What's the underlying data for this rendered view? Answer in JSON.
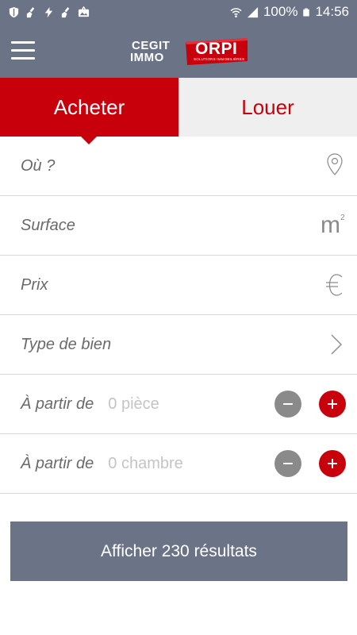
{
  "status_bar": {
    "battery": "100%",
    "time": "14:56"
  },
  "app_bar": {
    "logo_line1": "CEGIT",
    "logo_line2": "IMMO",
    "brand": "ORPI",
    "brand_tagline": "SOLUTIONS IMMOBILIÈRES"
  },
  "tabs": [
    {
      "label": "Acheter",
      "active": true
    },
    {
      "label": "Louer",
      "active": false
    }
  ],
  "form": {
    "location": {
      "label": "Où ?",
      "icon": "map-pin-icon"
    },
    "surface": {
      "label": "Surface",
      "icon": "square-meter-icon",
      "unit": "m",
      "exp": "2"
    },
    "price": {
      "label": "Prix",
      "icon": "euro-icon"
    },
    "type": {
      "label": "Type de bien",
      "icon": "chevron-right-icon"
    },
    "rooms": {
      "label": "À partir de",
      "value": "0 pièce"
    },
    "bedrooms": {
      "label": "À partir de",
      "value": "0 chambre"
    }
  },
  "cta": {
    "label": "Afficher 230 résultats"
  },
  "colors": {
    "brand_red": "#c8000b",
    "header_gray": "#6b7386",
    "inactive_tab": "#efefef",
    "minus_gray": "#8a8a8a"
  }
}
